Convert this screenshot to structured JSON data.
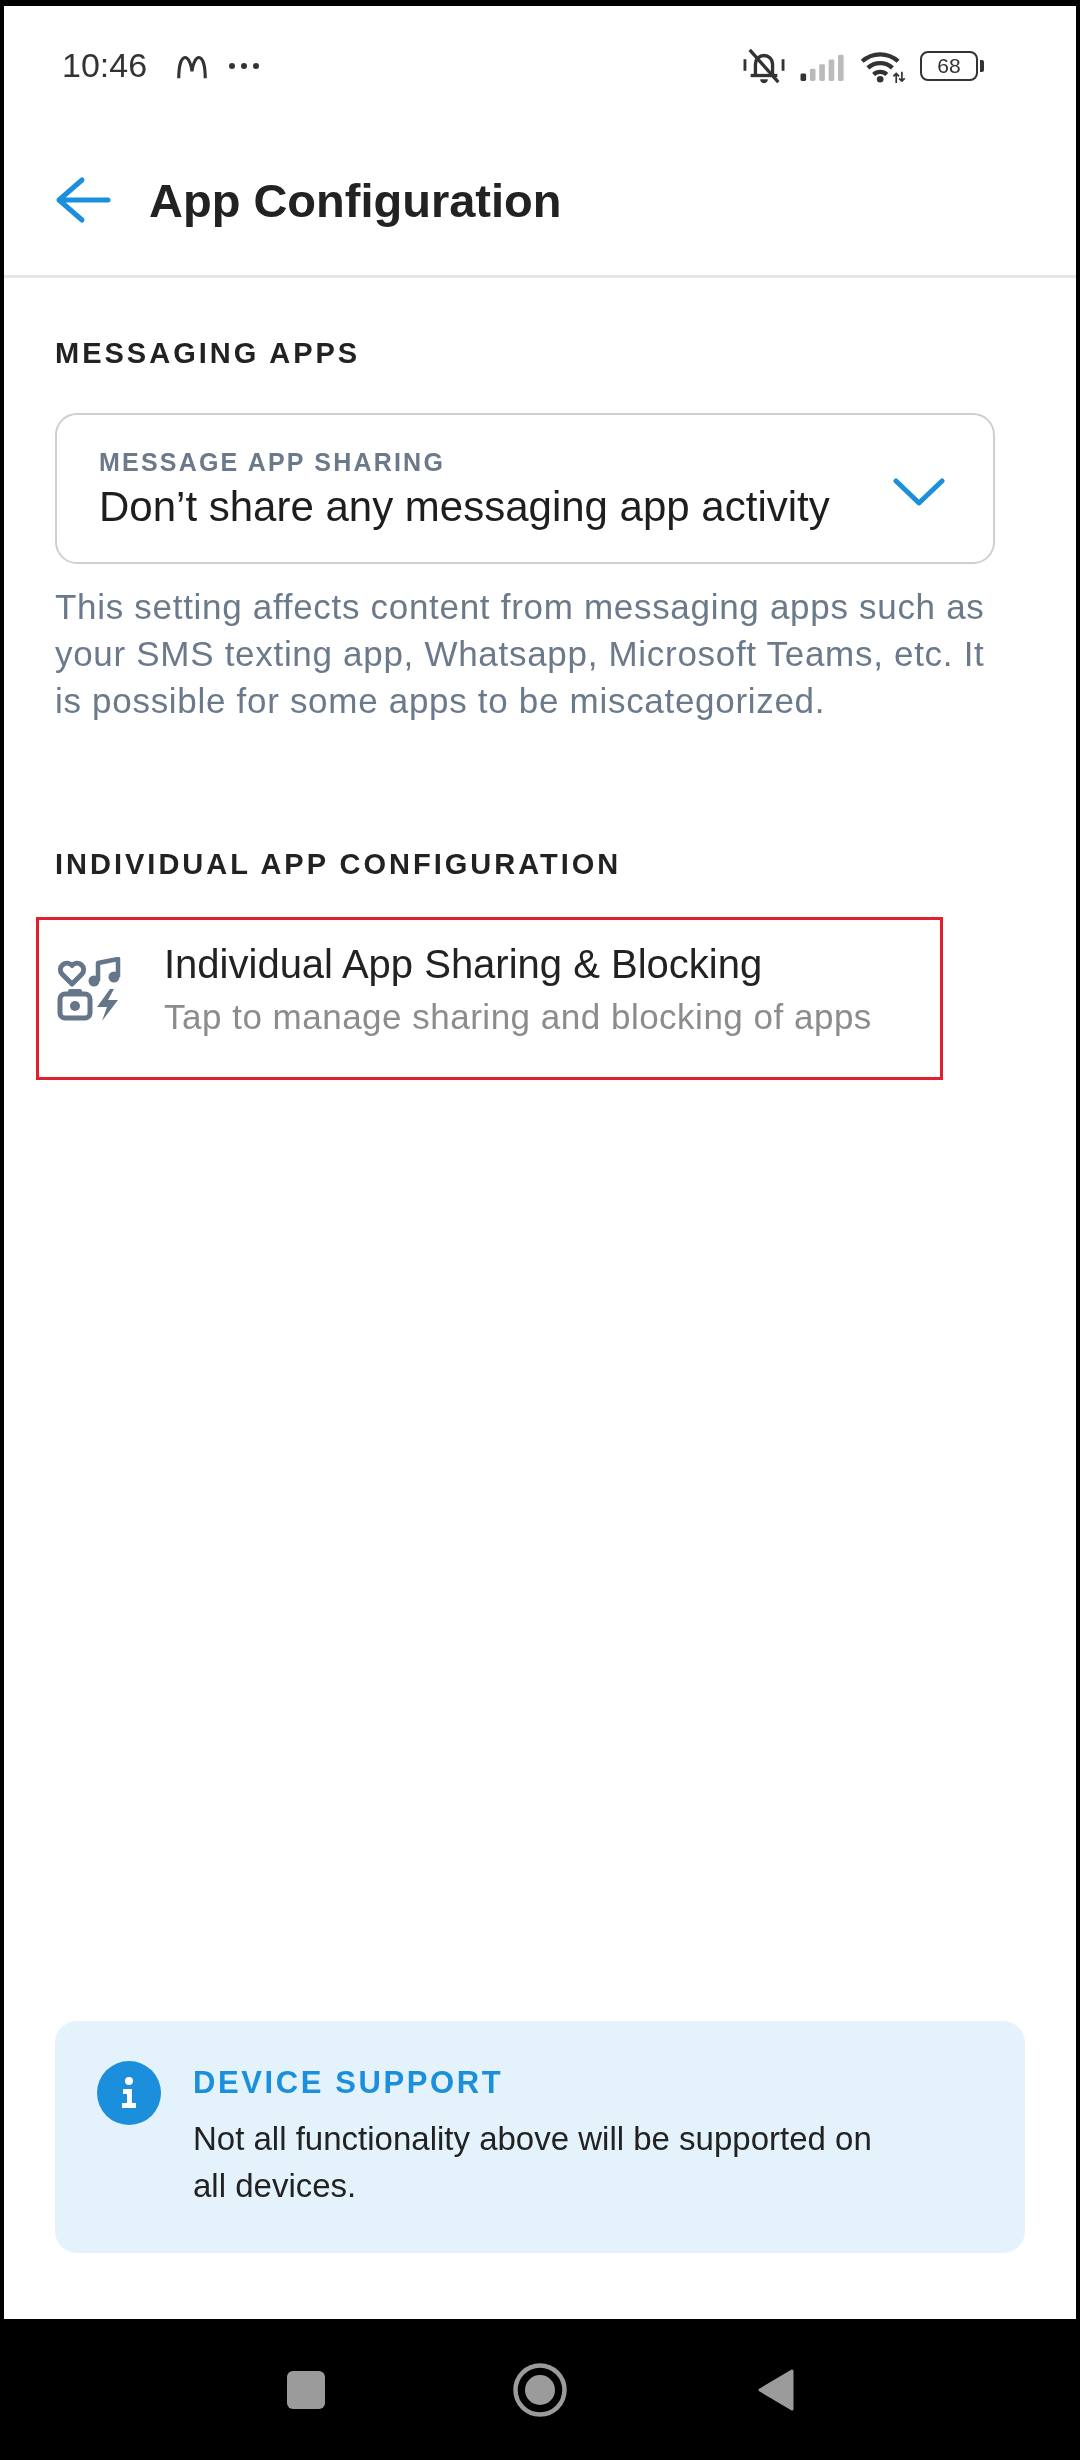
{
  "status_bar": {
    "time": "10:46",
    "battery": "68"
  },
  "header": {
    "title": "App Configuration"
  },
  "sections": [
    {
      "kind": "dropdown",
      "heading": "MESSAGING APPS",
      "dropdown": {
        "label": "MESSAGE APP SHARING",
        "value": "Don’t share any messaging app activity"
      },
      "help": "This setting affects content from messaging apps such as your SMS texting app, Whatsapp, Microsoft Teams, etc. It is possible for some apps to be miscategorized."
    },
    {
      "kind": "link_row",
      "heading": "INDIVIDUAL APP CONFIGURATION",
      "row": {
        "title": "Individual App Sharing & Blocking",
        "subtitle": "Tap to manage sharing and blocking of apps",
        "highlighted": true
      }
    }
  ],
  "notice": {
    "title": "DEVICE SUPPORT",
    "body": "Not all functionality above will be supported on all devices."
  }
}
